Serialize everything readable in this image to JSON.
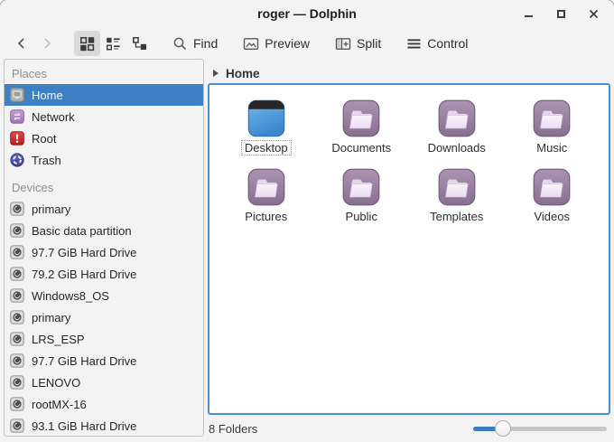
{
  "window": {
    "title": "roger — Dolphin"
  },
  "toolbar": {
    "find_label": "Find",
    "preview_label": "Preview",
    "split_label": "Split",
    "control_label": "Control"
  },
  "breadcrumb": {
    "label": "Home"
  },
  "sidebar": {
    "places": {
      "header": "Places",
      "items": [
        {
          "label": "Home",
          "icon": "home-icon",
          "selected": true
        },
        {
          "label": "Network",
          "icon": "network-icon",
          "selected": false
        },
        {
          "label": "Root",
          "icon": "root-icon",
          "selected": false
        },
        {
          "label": "Trash",
          "icon": "trash-icon",
          "selected": false
        }
      ]
    },
    "devices": {
      "header": "Devices",
      "items": [
        {
          "label": "primary",
          "icon": "hard-drive-icon"
        },
        {
          "label": "Basic data partition",
          "icon": "hard-drive-icon"
        },
        {
          "label": "97.7 GiB Hard Drive",
          "icon": "hard-drive-icon"
        },
        {
          "label": "79.2 GiB Hard Drive",
          "icon": "hard-drive-icon"
        },
        {
          "label": "Windows8_OS",
          "icon": "hard-drive-icon"
        },
        {
          "label": "primary",
          "icon": "hard-drive-icon"
        },
        {
          "label": "LRS_ESP",
          "icon": "hard-drive-icon"
        },
        {
          "label": "97.7 GiB Hard Drive",
          "icon": "hard-drive-icon"
        },
        {
          "label": "LENOVO",
          "icon": "hard-drive-icon"
        },
        {
          "label": "rootMX-16",
          "icon": "hard-drive-icon"
        },
        {
          "label": "93.1 GiB Hard Drive",
          "icon": "hard-drive-icon"
        }
      ]
    }
  },
  "main": {
    "folders": [
      {
        "label": "Desktop",
        "type": "desktop",
        "selected": true
      },
      {
        "label": "Documents",
        "type": "folder",
        "selected": false
      },
      {
        "label": "Downloads",
        "type": "folder",
        "selected": false
      },
      {
        "label": "Music",
        "type": "folder",
        "selected": false
      },
      {
        "label": "Pictures",
        "type": "folder",
        "selected": false
      },
      {
        "label": "Public",
        "type": "folder",
        "selected": false
      },
      {
        "label": "Templates",
        "type": "folder",
        "selected": false
      },
      {
        "label": "Videos",
        "type": "folder",
        "selected": false
      }
    ]
  },
  "statusbar": {
    "status_text": "8 Folders",
    "zoom_slider": {
      "value_percent": 22
    }
  },
  "colors": {
    "selection_blue": "#3e80c4",
    "focus_border": "#4a8fd4",
    "folder_purple": "#9b83a3",
    "folder_inner": "#f6eefa",
    "desktop_blue": "#4596dd",
    "root_red": "#cf2a2a",
    "network_purple": "#b78cc8",
    "trash_blue": "#3f4fa6",
    "slider_fill": "#3e7cc0"
  }
}
